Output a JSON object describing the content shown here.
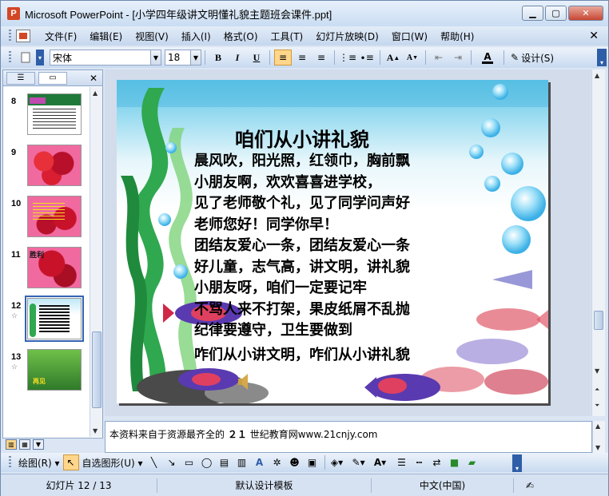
{
  "window": {
    "title": "Microsoft PowerPoint - [小学四年级讲文明懂礼貌主题班会课件.ppt]",
    "app_icon_letter": "P"
  },
  "menu": {
    "items": [
      "文件(F)",
      "编辑(E)",
      "视图(V)",
      "插入(I)",
      "格式(O)",
      "工具(T)",
      "幻灯片放映(D)",
      "窗口(W)",
      "帮助(H)"
    ]
  },
  "toolbar": {
    "font_name": "宋体",
    "font_size": "18",
    "bold": "B",
    "italic": "I",
    "underline": "U",
    "grow_font": "A",
    "shrink_font": "A",
    "font_color": "A",
    "design_label": "设计(S)"
  },
  "thumbnails": [
    {
      "num": "8",
      "star": "",
      "thumb_text": ""
    },
    {
      "num": "9",
      "star": "",
      "thumb_text": ""
    },
    {
      "num": "10",
      "star": "",
      "thumb_text": ""
    },
    {
      "num": "11",
      "star": "",
      "thumb_text": "胜利"
    },
    {
      "num": "12",
      "star": "☆",
      "thumb_text": ""
    },
    {
      "num": "13",
      "star": "☆",
      "thumb_text": "再见"
    }
  ],
  "slide": {
    "title": "咱们从小讲礼貌",
    "lines": [
      "晨风吹，阳光照，红领巾，胸前飘",
      "小朋友啊，欢欢喜喜进学校，",
      "见了老师敬个礼，见了同学问声好",
      "老师您好！同学你早！",
      "团结友爱心一条，团结友爱心一条",
      "好儿童，志气高，讲文明，讲礼貌",
      "小朋友呀，咱们一定要记牢",
      "不骂人来不打架，果皮纸屑不乱抛",
      "纪律要遵守，卫生要做到",
      "咋们从小讲文明，咋们从小讲礼貌"
    ]
  },
  "notes": {
    "text_prefix": "本资料来自于资源最齐全的",
    "site_bold": "２１",
    "text_suffix": "世纪教育网www.21cnjy.com"
  },
  "drawbar": {
    "draw_label": "绘图(R)",
    "autoshape_label": "自选图形(U)"
  },
  "status": {
    "slide_position": "幻灯片 12 / 13",
    "design_template": "默认设计模板",
    "language": "中文(中国)"
  },
  "colors": {
    "accent_blue": "#2f5ea8",
    "selected_toolbar": "#ffd68a",
    "seaweed_green": "#2fa84f",
    "bubble_blue": "#5ac4f0",
    "rose_red": "#c8122a"
  }
}
